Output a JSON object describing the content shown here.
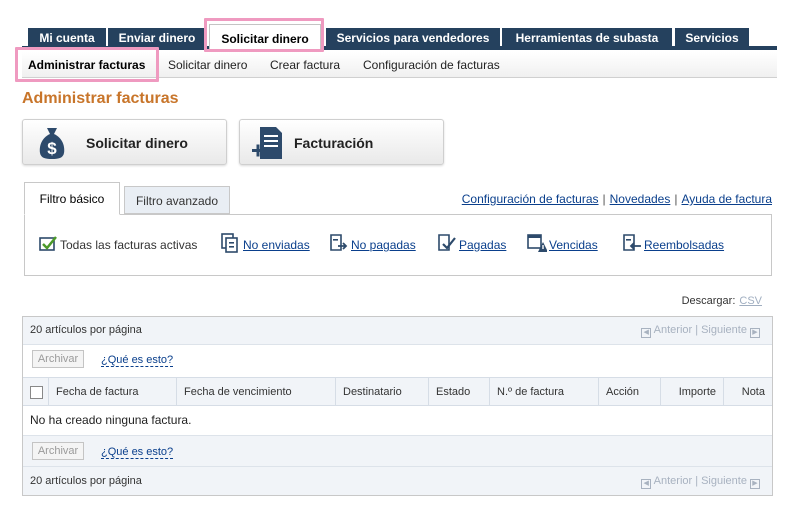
{
  "top_nav": {
    "tabs": [
      {
        "label": "Mi cuenta"
      },
      {
        "label": "Enviar dinero"
      },
      {
        "label": "Solicitar dinero",
        "active": true
      },
      {
        "label": "Servicios para vendedores"
      },
      {
        "label": "Herramientas de subasta"
      },
      {
        "label": "Servicios"
      }
    ]
  },
  "sub_nav": {
    "items": [
      {
        "label": "Administrar facturas",
        "active": true
      },
      {
        "label": "Solicitar dinero"
      },
      {
        "label": "Crear factura"
      },
      {
        "label": "Configuración de facturas"
      }
    ]
  },
  "page_title": "Administrar facturas",
  "actions": {
    "request_money": {
      "label": "Solicitar dinero",
      "icon": "money-bag-icon"
    },
    "billing": {
      "label": "Facturación",
      "icon": "invoice-icon"
    }
  },
  "filter_tabs": {
    "basic": "Filtro básico",
    "advanced": "Filtro avanzado"
  },
  "help_links": {
    "settings": "Configuración de facturas",
    "news": "Novedades",
    "help": "Ayuda de factura"
  },
  "filters": {
    "all_active": "Todas las facturas activas",
    "unsent": "No enviadas",
    "unpaid": "No pagadas",
    "paid": "Pagadas",
    "overdue": "Vencidas",
    "refunded": "Reembolsadas"
  },
  "download": {
    "label": "Descargar:",
    "format": "CSV"
  },
  "table": {
    "per_page": "20 artículos por página",
    "prev": "Anterior",
    "next": "Siguiente",
    "archive": "Archivar",
    "what_is_this": "¿Qué es esto?",
    "columns": [
      "Fecha de factura",
      "Fecha de vencimiento",
      "Destinatario",
      "Estado",
      "N.º de factura",
      "Acción",
      "Importe",
      "Nota"
    ],
    "empty_message": "No ha creado ninguna factura."
  },
  "colors": {
    "nav_dark": "#25415e",
    "title_orange": "#c8752a",
    "link_blue": "#0a3f8c",
    "highlight_pink": "#ef9ac0"
  }
}
